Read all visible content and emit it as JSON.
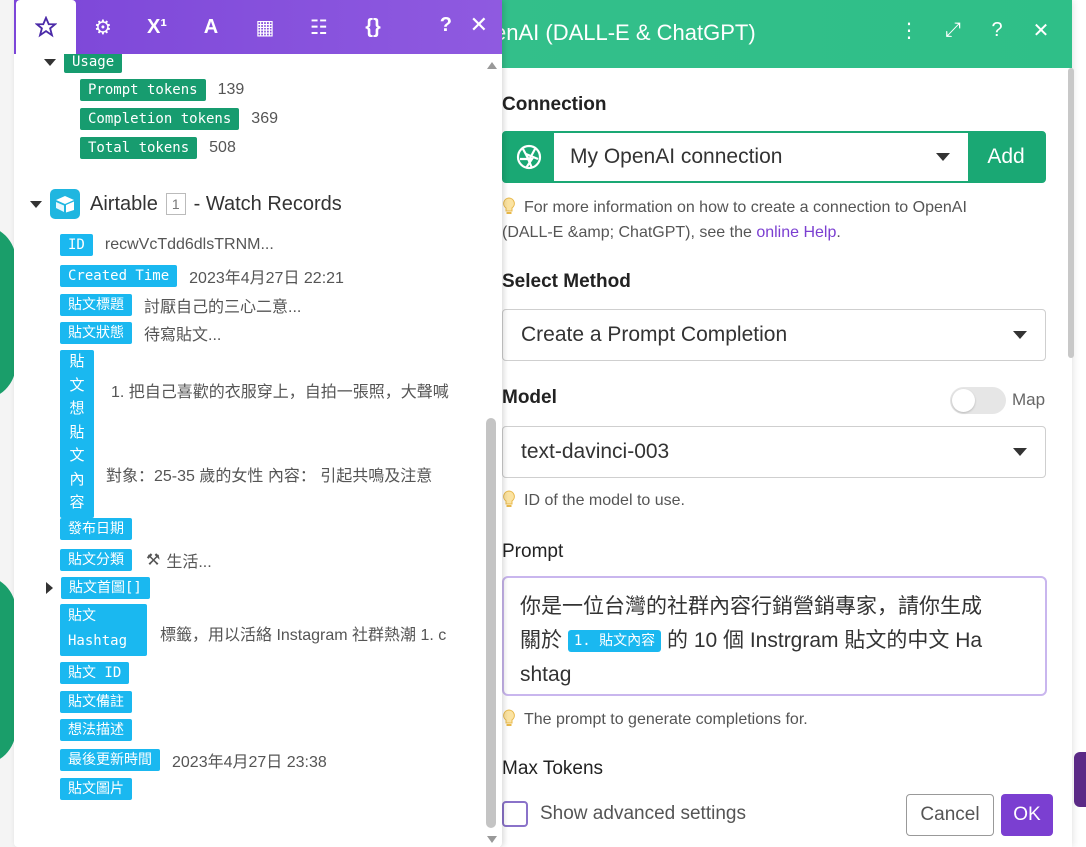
{
  "dialog": {
    "title": "enAI (DALL-E & ChatGPT)",
    "header_icons": [
      "more-vertical-icon",
      "expand-icon",
      "help-icon",
      "close-icon"
    ],
    "connection_label": "Connection",
    "connection_value": "My OpenAI connection",
    "add_label": "Add",
    "connection_hint_1": "For more information on how to create a connection to OpenAI",
    "connection_hint_2": "(DALL-E &amp; ChatGPT), see the ",
    "connection_hint_link": "online Help",
    "connection_hint_end": ".",
    "method_label": "Select Method",
    "method_value": "Create a Prompt Completion",
    "model_label": "Model",
    "map_label": "Map",
    "model_value": "text-davinci-003",
    "model_hint": "ID of the model to use.",
    "prompt_label": "Prompt",
    "prompt_text_1": "你是一位台灣的社群內容行銷營銷專家，請你生成",
    "prompt_text_2a": "關於",
    "prompt_pill": "1. 貼文內容",
    "prompt_text_2b": "的 10 個 Instrgram 貼文的中文 Ha",
    "prompt_text_3": "shtag",
    "prompt_hint": "The prompt to generate completions for.",
    "max_tokens_label": "Max Tokens",
    "advanced_label": "Show advanced settings",
    "cancel_label": "Cancel",
    "ok_label": "OK"
  },
  "panel": {
    "tabs": [
      "star-icon",
      "gear-icon",
      "superscript-icon",
      "text-icon",
      "calendar-icon",
      "table-icon",
      "braces-icon"
    ],
    "tab_glyphs": [
      "☆",
      "⚙",
      "X¹",
      "A",
      "▦",
      "☷",
      "{}"
    ],
    "help_glyph": "?",
    "close_glyph": "✕",
    "usage": {
      "label": "Usage",
      "items": [
        {
          "key": "Prompt tokens",
          "value": "139"
        },
        {
          "key": "Completion tokens",
          "value": "369"
        },
        {
          "key": "Total tokens",
          "value": "508"
        }
      ]
    },
    "module": {
      "name": "Airtable",
      "badge": "1",
      "action": "- Watch Records"
    },
    "fields": {
      "id_key": "ID",
      "id_val": "recwVcTdd6dlsTRNM...",
      "created_key": "Created Time",
      "created_val": "2023年4月27日 22:21",
      "title_key": "貼文標題",
      "title_val": "討厭自己的三心二意...",
      "status_key": "貼文狀態",
      "status_val": "待寫貼文...",
      "idea_key": [
        "貼",
        "文",
        "想",
        "貼",
        "文",
        "內",
        "容"
      ],
      "idea_val_1": "1. 把自己喜歡的衣服穿上，自拍一張照，大聲喊",
      "idea_val_2": "對象：25-35 歲的女性 內容： 引起共鳴及注意",
      "publish_key": "發布日期",
      "category_key": "貼文分類",
      "category_val": "生活...",
      "cover_key": "貼文首圖[]",
      "hashtag_key_1": "貼文",
      "hashtag_key_2": "Hashtag",
      "hashtag_val": "標籤，用以活絡 Instagram 社群熱潮 1. c",
      "postid_key": "貼文 ID",
      "note_key": "貼文備註",
      "desc_key": "想法描述",
      "updated_key": "最後更新時間",
      "updated_val": "2023年4月27日 23:38",
      "image_key": "貼文圖片"
    }
  },
  "colors": {
    "header_green": "#33bf8a",
    "tab_purple": "#7c46d8",
    "pill_green": "#179c6f",
    "pill_blue": "#1ab8f0",
    "ok_purple": "#7b3fd1"
  }
}
